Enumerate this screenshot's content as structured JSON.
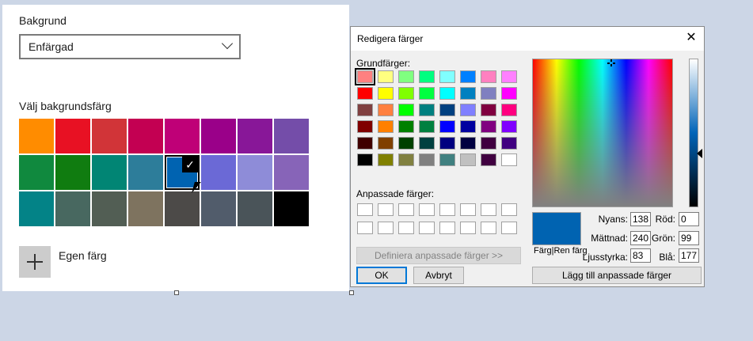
{
  "settings": {
    "background_label": "Bakgrund",
    "background_value": "Enfärgad",
    "color_heading": "Välj bakgrundsfärg",
    "custom_color_label": "Egen färg",
    "swatches": [
      "#ff8c00",
      "#e81123",
      "#d13438",
      "#c30052",
      "#bf0077",
      "#9a0089",
      "#881798",
      "#744da9",
      "#10893e",
      "#107c10",
      "#018574",
      "#2d7d9a",
      "#0063b1",
      "#6b69d6",
      "#8e8cd8",
      "#8764b8",
      "#038387",
      "#486860",
      "#525e54",
      "#7e735f",
      "#4c4a48",
      "#515c6b",
      "#4a5459",
      "#000000"
    ],
    "selected_index": 12,
    "check_glyph": "✓"
  },
  "dialog": {
    "title": "Redigera färger",
    "close_glyph": "✕",
    "basic_colors_label": "Grundfärger:",
    "basic_colors": [
      "#ff8080",
      "#ffff80",
      "#80ff80",
      "#00ff80",
      "#80ffff",
      "#0080ff",
      "#ff80c0",
      "#ff80ff",
      "#ff0000",
      "#ffff00",
      "#80ff00",
      "#00ff40",
      "#00ffff",
      "#0080c0",
      "#8080c0",
      "#ff00ff",
      "#804040",
      "#ff8040",
      "#00ff00",
      "#008080",
      "#004080",
      "#8080ff",
      "#800040",
      "#ff0080",
      "#800000",
      "#ff8000",
      "#008000",
      "#008040",
      "#0000ff",
      "#0000a0",
      "#800080",
      "#8000ff",
      "#400000",
      "#804000",
      "#004000",
      "#004040",
      "#000080",
      "#000040",
      "#400040",
      "#400080",
      "#000000",
      "#808000",
      "#808040",
      "#808080",
      "#408080",
      "#c0c0c0",
      "#400040",
      "#ffffff"
    ],
    "custom_colors_label": "Anpassade färger:",
    "custom_colors": [
      "#ffffff",
      "#ffffff",
      "#ffffff",
      "#ffffff",
      "#ffffff",
      "#ffffff",
      "#ffffff",
      "#ffffff",
      "#ffffff",
      "#ffffff",
      "#ffffff",
      "#ffffff",
      "#ffffff",
      "#ffffff",
      "#ffffff",
      "#ffffff"
    ],
    "define_custom_label": "Definiera anpassade färger >>",
    "ok_label": "OK",
    "cancel_label": "Avbryt",
    "preview_label": "Färg|Ren färg",
    "preview_color": "#0063b1",
    "hue_label": "Nyans:",
    "hue_value": "138",
    "sat_label": "Mättnad:",
    "sat_value": "240",
    "lum_label": "Ljusstyrka:",
    "lum_value": "83",
    "red_label": "Röd:",
    "red_value": "0",
    "green_label": "Grön:",
    "green_value": "99",
    "blue_label": "Blå:",
    "blue_value": "177",
    "add_custom_label": "Lägg till anpassade färger"
  }
}
